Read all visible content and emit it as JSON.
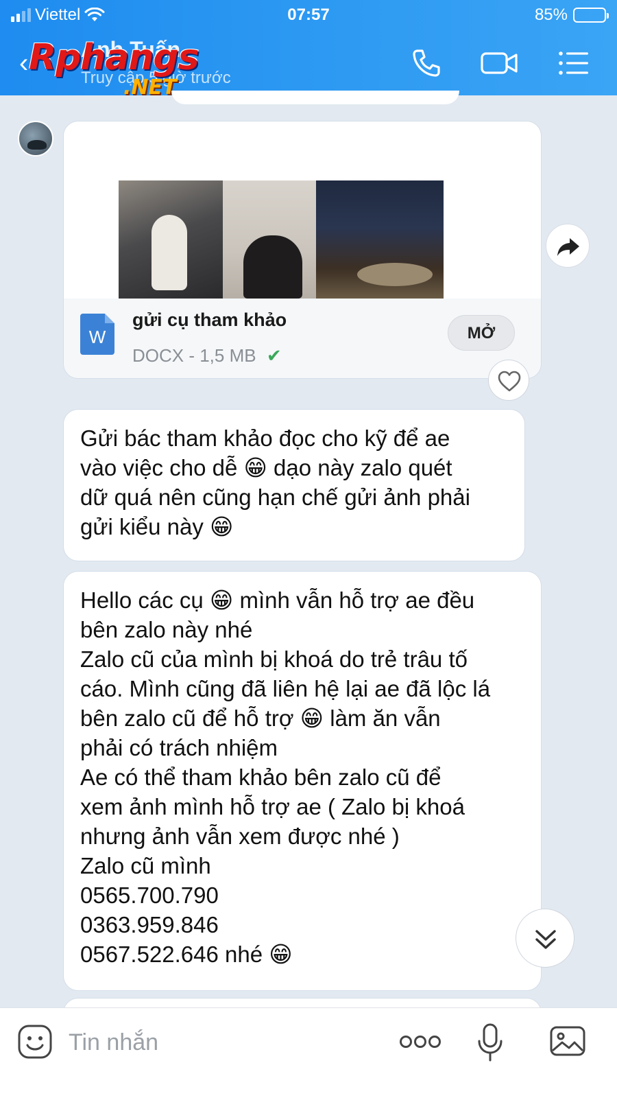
{
  "status_bar": {
    "carrier": "Viettel",
    "time": "07:57",
    "battery": "85%",
    "battery_level": 0.85
  },
  "header": {
    "contact_name": "Anh Tuấn",
    "last_seen": "Truy cập 5 giờ trước",
    "watermark": "Rphangs",
    "watermark_suffix": ".NET",
    "icons": [
      "back-icon",
      "phone-icon",
      "video-call-icon",
      "menu-list-icon"
    ]
  },
  "file_message": {
    "file_name": "gửi cụ tham khảo",
    "file_meta": "DOCX - 1,5 MB",
    "file_type_letter": "W",
    "open_label": "MỞ",
    "status_icon": "check-icon"
  },
  "messages": [
    {
      "text": "Gửi bác tham khảo đọc cho kỹ để ae\nvào việc cho dễ 😁 dạo này zalo quét\ndữ quá nên cũng hạn chế gửi ảnh phải\ngửi kiểu này 😁"
    },
    {
      "text": "Hello các cụ 😁 mình vẫn hỗ trợ ae đều\nbên zalo này nhé\nZalo cũ của mình bị khoá do trẻ trâu tố\ncáo. Mình cũng đã liên hệ lại ae đã lộc lá\nbên zalo cũ để hỗ trợ 😁 làm ăn vẫn\nphải có trách nhiệm\nAe có thể tham khảo bên zalo cũ để\nxem ảnh mình hỗ trợ ae ( Zalo bị khoá\nnhưng ảnh vẫn xem được nhé )\nZalo cũ mình\n0565.700.790\n0363.959.846\n0567.522.646 nhé 😁"
    }
  ],
  "input_bar": {
    "placeholder": "Tin nhắn",
    "icons": [
      "emoji-icon",
      "more-icon",
      "microphone-icon",
      "image-icon"
    ]
  },
  "colors": {
    "header_blue": "#2f9bf2",
    "chat_background": "#e2e9f1",
    "check_green": "#3aa85a",
    "logo_red": "#e01818",
    "logo_orange": "#ffb000"
  }
}
